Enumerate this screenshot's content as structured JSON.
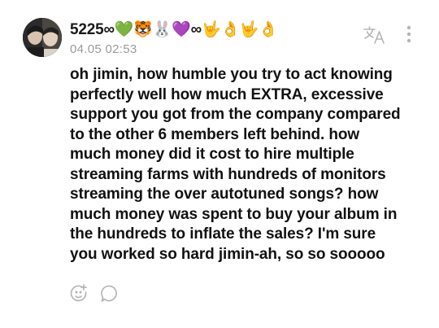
{
  "post": {
    "author_name": "5225∞💚🐯🐰💜∞🤟👌🤟👌",
    "timestamp": "04.05 02:53",
    "body": "oh jimin,  how humble you try to act knowing\nperfectly well how much EXTRA, excessive\nsupport you got from the company compared\nto the other 6 members left behind. how\nmuch money did it cost to hire multiple\nstreaming farms with hundreds of monitors\nstreaming the over autotuned songs? how\nmuch money was spent to buy your album in\nthe hundreds to inflate the sales? I'm sure\nyou worked so hard  jimin-ah, so so sooooo"
  },
  "icons": {
    "avatar": "profile-photo",
    "translate": "translate-icon",
    "more": "more-vertical-icon",
    "reaction": "add-reaction-icon",
    "reply": "comment-bubble-icon"
  },
  "colors": {
    "text": "#111111",
    "timestamp": "#9a9a9a",
    "icon": "#b5b5b5",
    "background": "#ffffff"
  }
}
